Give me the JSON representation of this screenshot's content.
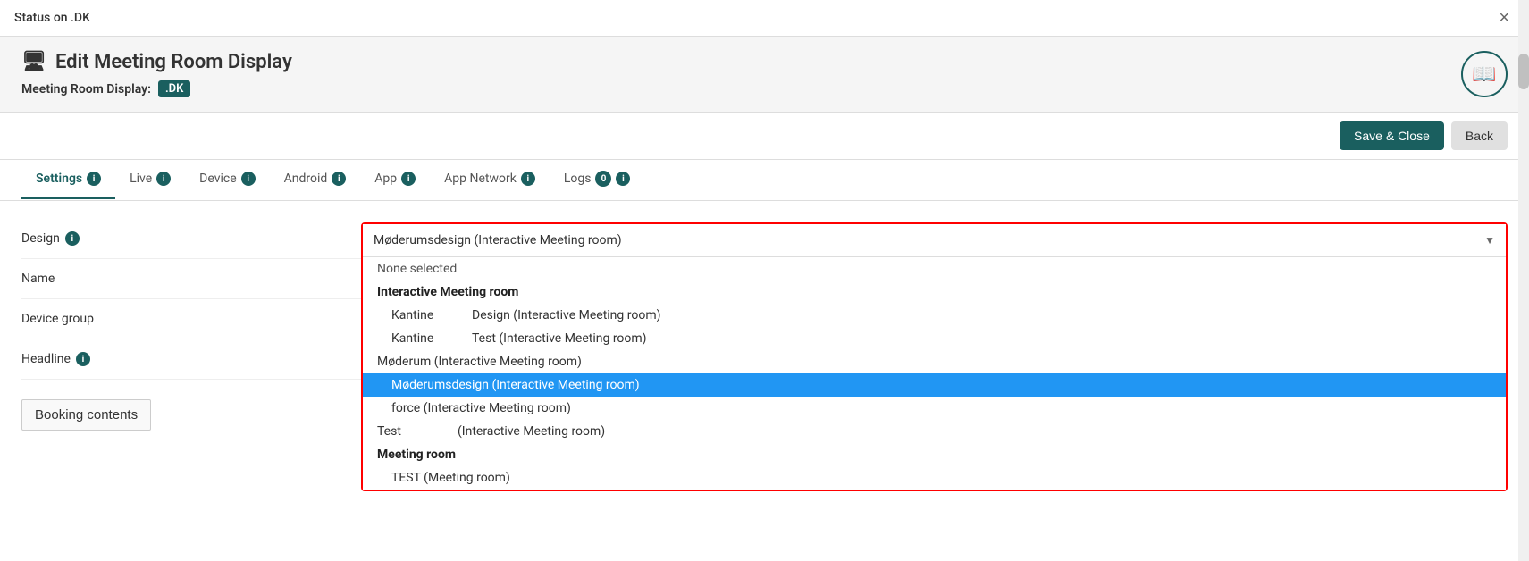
{
  "topbar": {
    "title": "Status on .DK",
    "close_label": "×"
  },
  "header": {
    "title": "Edit Meeting Room Display",
    "subtitle_label": "Meeting Room Display:",
    "badge": ".DK",
    "logo_icon": "📖"
  },
  "toolbar": {
    "save_label": "Save & Close",
    "back_label": "Back"
  },
  "tabs": [
    {
      "id": "settings",
      "label": "Settings",
      "active": true,
      "badge": null,
      "info": true
    },
    {
      "id": "live",
      "label": "Live",
      "active": false,
      "badge": null,
      "info": true
    },
    {
      "id": "device",
      "label": "Device",
      "active": false,
      "badge": null,
      "info": true
    },
    {
      "id": "android",
      "label": "Android",
      "active": false,
      "badge": null,
      "info": true
    },
    {
      "id": "app",
      "label": "App",
      "active": false,
      "badge": null,
      "info": true
    },
    {
      "id": "appnetwork",
      "label": "App Network",
      "active": false,
      "badge": null,
      "info": true
    },
    {
      "id": "logs",
      "label": "Logs",
      "active": false,
      "badge": "0",
      "info": true
    }
  ],
  "fields": [
    {
      "label": "Design",
      "info": true
    },
    {
      "label": "Name",
      "info": false
    },
    {
      "label": "Device group",
      "info": false
    },
    {
      "label": "Headline",
      "info": true
    }
  ],
  "design_dropdown": {
    "selected": "Møderumsdesign (Interactive Meeting room)",
    "options": [
      {
        "id": "none",
        "label": "None selected",
        "type": "none",
        "indent": false
      },
      {
        "id": "grp1",
        "label": "Interactive Meeting room",
        "type": "group",
        "indent": false
      },
      {
        "id": "kantine-design",
        "col1": "Kantine",
        "col2": "Design (Interactive Meeting room)",
        "type": "item",
        "indent": true
      },
      {
        "id": "kantine-test",
        "col1": "Kantine",
        "col2": "Test (Interactive Meeting room)",
        "type": "item",
        "indent": true
      },
      {
        "id": "moderum",
        "label": "Møderum (Interactive Meeting room)",
        "type": "item",
        "indent": false
      },
      {
        "id": "moderumsdesign",
        "label": "Møderumsdesign (Interactive Meeting room)",
        "type": "item-selected",
        "indent": true
      },
      {
        "id": "force",
        "label": "force (Interactive Meeting room)",
        "type": "item",
        "indent": true
      },
      {
        "id": "test",
        "col1": "Test",
        "col2": "(Interactive Meeting room)",
        "type": "item",
        "indent": false
      },
      {
        "id": "grp2",
        "label": "Meeting room",
        "type": "group",
        "indent": false
      },
      {
        "id": "test-meeting",
        "label": "TEST (Meeting room)",
        "type": "item",
        "indent": true
      }
    ]
  },
  "booking_contents": {
    "label": "Booking contents"
  }
}
